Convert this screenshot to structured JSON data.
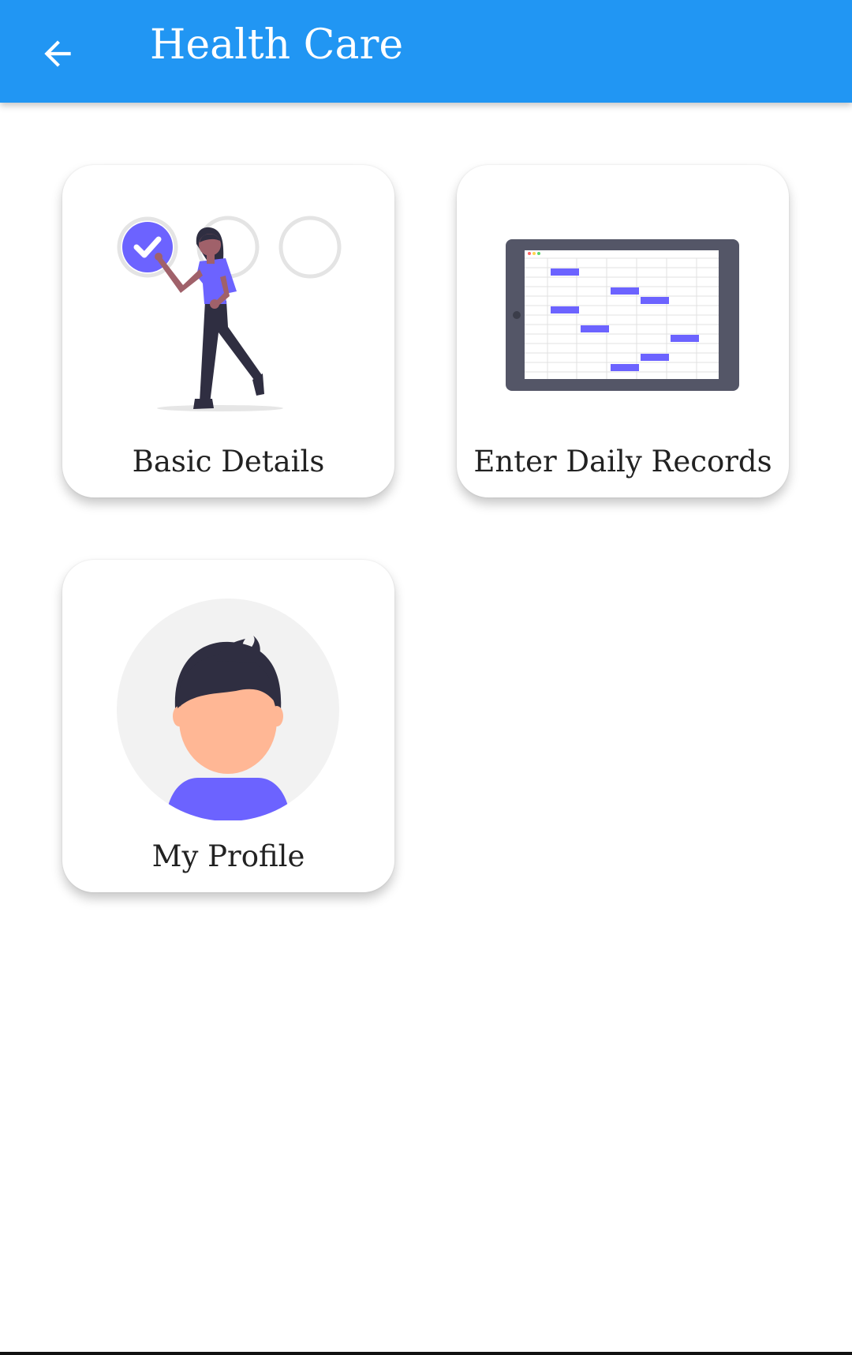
{
  "app_bar": {
    "title": "Health Care",
    "back_icon": "arrow-left-icon",
    "color": "#2196F3"
  },
  "cards": [
    {
      "label": "Basic Details",
      "illustration": "woman-checklist-illustration"
    },
    {
      "label": "Enter Daily Records",
      "illustration": "tablet-schedule-illustration"
    },
    {
      "label": "My Profile",
      "illustration": "profile-avatar-illustration"
    }
  ],
  "colors": {
    "accent": "#6C63FF",
    "text": "#222222"
  }
}
